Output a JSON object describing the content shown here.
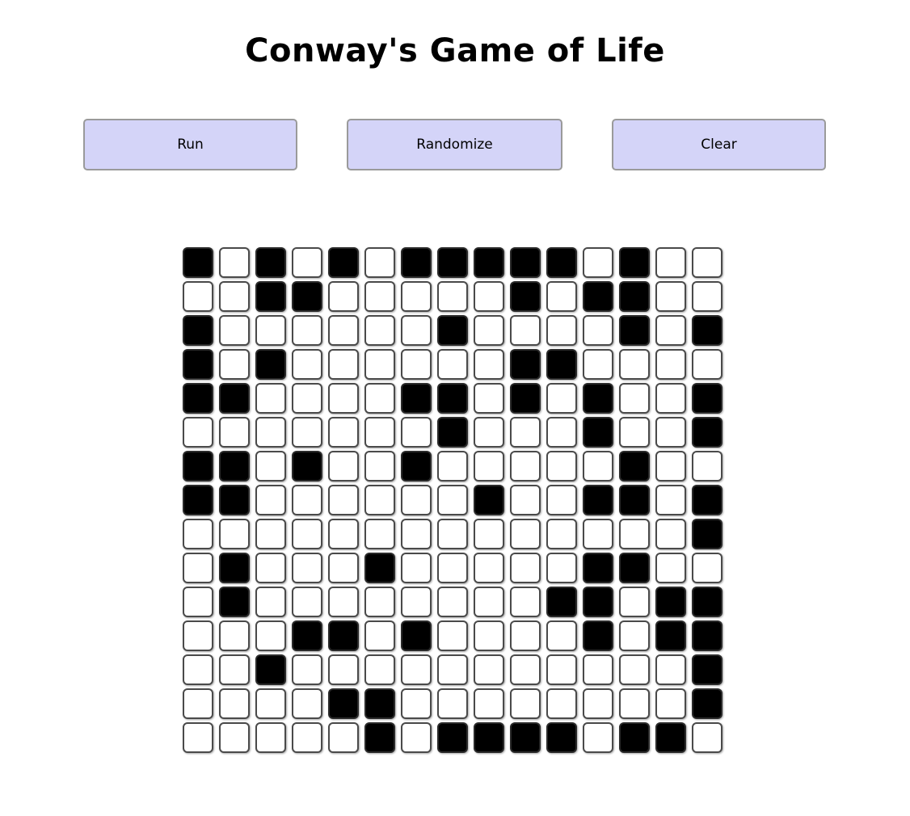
{
  "title": "Conway's Game of Life",
  "controls": {
    "run_label": "Run",
    "randomize_label": "Randomize",
    "clear_label": "Clear"
  },
  "colors": {
    "button_bg": "#d4d4f8",
    "alive": "#000000",
    "dead": "#ffffff"
  },
  "board": {
    "rows": 15,
    "cols": 15,
    "cells": [
      [
        1,
        0,
        1,
        0,
        1,
        0,
        1,
        1,
        1,
        1,
        1,
        0,
        1,
        0,
        0
      ],
      [
        0,
        0,
        1,
        1,
        0,
        0,
        0,
        0,
        0,
        1,
        0,
        1,
        1,
        0,
        0
      ],
      [
        1,
        0,
        0,
        0,
        0,
        0,
        0,
        1,
        0,
        0,
        0,
        0,
        1,
        0,
        1
      ],
      [
        1,
        0,
        1,
        0,
        0,
        0,
        0,
        0,
        0,
        1,
        1,
        0,
        0,
        0,
        0
      ],
      [
        1,
        1,
        0,
        0,
        0,
        0,
        1,
        1,
        0,
        1,
        0,
        1,
        0,
        0,
        1
      ],
      [
        0,
        0,
        0,
        0,
        0,
        0,
        0,
        1,
        0,
        0,
        0,
        1,
        0,
        0,
        1
      ],
      [
        1,
        1,
        0,
        1,
        0,
        0,
        1,
        0,
        0,
        0,
        0,
        0,
        1,
        0,
        0
      ],
      [
        1,
        1,
        0,
        0,
        0,
        0,
        0,
        0,
        1,
        0,
        0,
        1,
        1,
        0,
        1
      ],
      [
        0,
        0,
        0,
        0,
        0,
        0,
        0,
        0,
        0,
        0,
        0,
        0,
        0,
        0,
        1
      ],
      [
        0,
        1,
        0,
        0,
        0,
        1,
        0,
        0,
        0,
        0,
        0,
        1,
        1,
        0,
        0
      ],
      [
        0,
        1,
        0,
        0,
        0,
        0,
        0,
        0,
        0,
        0,
        1,
        1,
        0,
        1,
        1
      ],
      [
        0,
        0,
        0,
        1,
        1,
        0,
        1,
        0,
        0,
        0,
        0,
        1,
        0,
        1,
        1
      ],
      [
        0,
        0,
        1,
        0,
        0,
        0,
        0,
        0,
        0,
        0,
        0,
        0,
        0,
        0,
        1
      ],
      [
        0,
        0,
        0,
        0,
        1,
        1,
        0,
        0,
        0,
        0,
        0,
        0,
        0,
        0,
        1
      ],
      [
        0,
        0,
        0,
        0,
        0,
        1,
        0,
        1,
        1,
        1,
        1,
        0,
        1,
        1,
        0
      ]
    ]
  }
}
